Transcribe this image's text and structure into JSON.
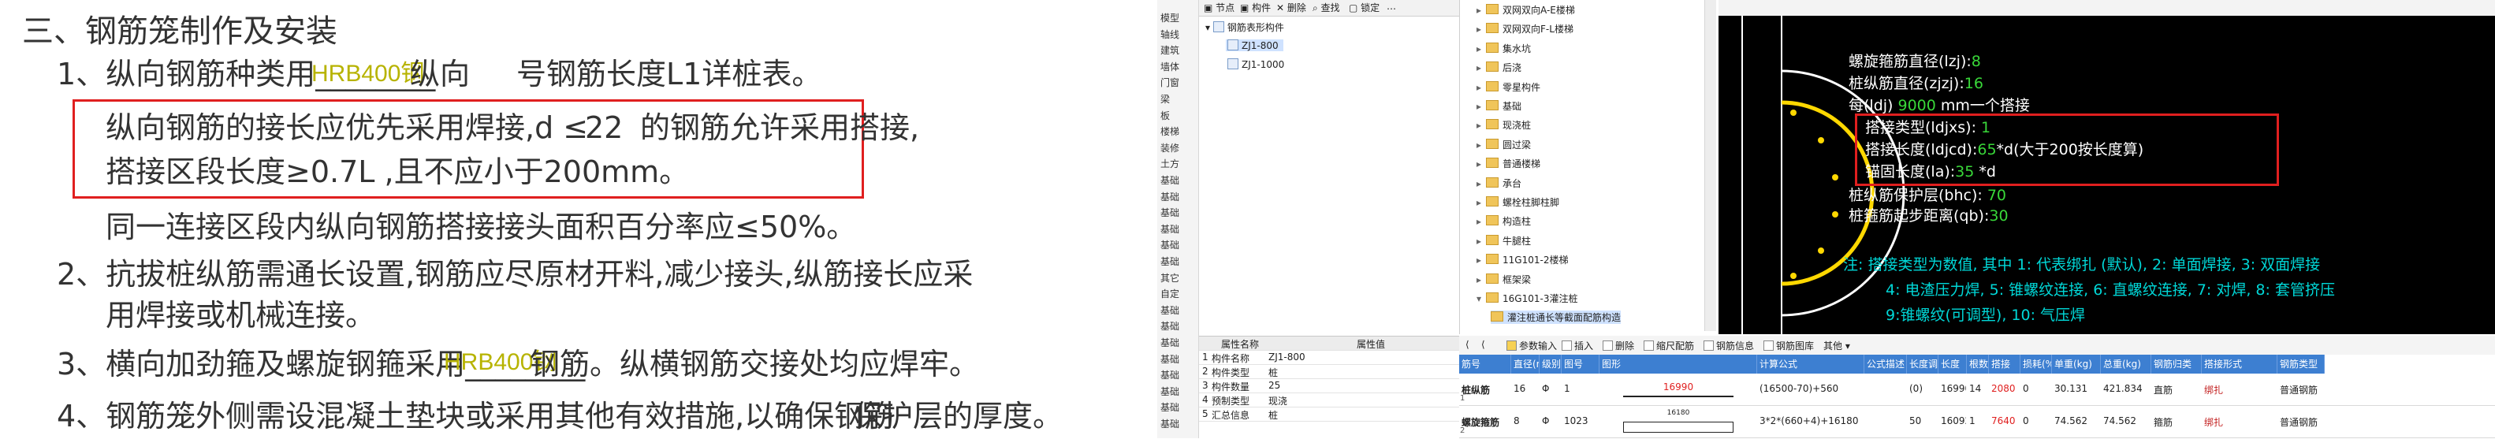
{
  "notes": {
    "heading": "三、钢筋笼制作及安装",
    "line1_a": "1、纵向钢筋种类用",
    "line1_blank": "________",
    "line1_b": "纵向",
    "line1_c": "号钢筋长度L1详桩表。",
    "hrb_1": "HRB400钢",
    "line1_overlap": "筋长度",
    "line2": "纵向钢筋的接长应优先采用焊接,d ≤",
    "line2_num": "22",
    "line2_end": "的钢筋允许采用搭接,",
    "line3": "搭接区段长度≥0.7L  ,且不应小于200mm。",
    "line4": "同一连接区段内纵向钢筋搭接接头面积百分率应≤50%。",
    "line5": "2、抗拔桩纵筋需通长设置,钢筋应尽原材开料,减少接头,纵筋接长应采",
    "line6": "用焊接或机械连接。",
    "line7_a": "3、横向加劲箍及螺旋钢箍采用",
    "line7_blank": "________",
    "line7_b": "钢筋。纵横钢筋交接处均应焊牢。",
    "hrb_2": "HRB400钢",
    "line8_a": "4、钢筋笼外侧需设混凝土垫块或采用其他有效措施,以确保钢筋",
    "line8_b": "保护层的厚度。"
  },
  "side_strip": [
    "模型",
    "轴线",
    "建筑",
    "墙体",
    "门窗",
    "梁",
    "板",
    "楼梯",
    "装修",
    "土方",
    "基础",
    "基础",
    "基础",
    "基础",
    "基础",
    "基础",
    "其它",
    "自定",
    "基础",
    "基础",
    "基础",
    "基础",
    "基础",
    "基础",
    "基础",
    "基础"
  ],
  "comp_toolbar": [
    "节点",
    "构件",
    "删除",
    "查找",
    "锁定",
    "…"
  ],
  "comp_tree": {
    "root": "钢筋表形构件",
    "items": [
      "ZJ1-800",
      "ZJ1-1000"
    ]
  },
  "lib_tree": [
    "双网双向A-E楼梯",
    "双网双向F-L楼梯",
    "集水坑",
    "后浇",
    "零星构件",
    "基础",
    "现浇桩",
    "圆过梁",
    "普通楼梯",
    "承台",
    "螺栓柱脚柱脚",
    "构造柱",
    "牛腿柱",
    "11G101-2楼梯",
    "框架梁",
    "16G101-3灌注桩",
    "灌注桩通长等截面配筋构造"
  ],
  "props": {
    "head": [
      "属性名称",
      "属性值"
    ],
    "rows": [
      [
        "1",
        "构件名称",
        "ZJ1-800"
      ],
      [
        "2",
        "构件类型",
        "桩"
      ],
      [
        "3",
        "构件数量",
        "25"
      ],
      [
        "4",
        "预制类型",
        "现浇"
      ],
      [
        "5",
        "汇总信息",
        "桩"
      ]
    ]
  },
  "preview": {
    "l1_label": "螺旋箍筋直径(lzj):",
    "l1_val": "8",
    "l2_label": "桩纵筋直径(zjzj):",
    "l2_val": "16",
    "l3_a": "每(ldj)",
    "l3_val": "9000",
    "l3_b": "mm一个搭接",
    "l4_label": "搭接类型(ldjxs):",
    "l4_val": "1",
    "l5_label": "搭接长度(ldjcd):",
    "l5_val": "65",
    "l5_b": "*d(大于200按长度算)",
    "l6_label": "锚固长度(la):",
    "l6_val": "35",
    "l6_b": "*d",
    "l7_label": "桩纵筋保护层(bhc):",
    "l7_val": "70",
    "l8_label": "桩箍筋起步距离(qb):",
    "l8_val": "30",
    "note1": "注: 搭接类型为数值, 其中 1: 代表绑扎 (默认), 2: 单面焊接, 3: 双面焊接",
    "note2": "4: 电渣压力焊, 5: 锥螺纹连接, 6: 直螺纹连接, 7: 对焊, 8: 套管挤压",
    "note3": "9:锥螺纹(可调型), 10: 气压焊"
  },
  "rebar_toolbar": [
    "参数输入",
    "插入",
    "删除",
    "缩尺配筋",
    "钢筋信息",
    "钢筋图库",
    "其他"
  ],
  "rebar_table": {
    "headers": [
      "筋号",
      "直径(mm)",
      "级别",
      "图号",
      "图形",
      "计算公式",
      "公式描述",
      "长度调整",
      "长度",
      "根数",
      "搭接",
      "损耗(%)",
      "单重(kg)",
      "总重(kg)",
      "钢筋归类",
      "搭接形式",
      "钢筋类型"
    ],
    "rows": [
      {
        "idx": "1",
        "name": "桩纵筋",
        "dia": "16",
        "grade": "Φ",
        "fig": "1",
        "shape_val": "16990",
        "formula": "(16500-70)+560",
        "desc": "",
        "adj": "(0)",
        "len": "16990",
        "count": "14",
        "lap": "2080",
        "loss": "0",
        "unit": "30.131",
        "total": "421.834",
        "cat": "直筋",
        "laptype": "绑扎",
        "type": "普通钢筋"
      },
      {
        "idx": "2",
        "name": "螺旋箍筋",
        "dia": "8",
        "grade": "Φ",
        "fig": "1023",
        "shape_val": "16180",
        "formula": "3*2*(660+4)+16180",
        "desc": "",
        "adj": "50",
        "len": "16092",
        "count": "1",
        "lap": "7640",
        "loss": "0",
        "unit": "74.562",
        "total": "74.562",
        "cat": "箍筋",
        "laptype": "绑扎",
        "type": "普通钢筋"
      }
    ]
  },
  "colors": {
    "accent": "#3d7fd1",
    "highlight": "#e01f1f",
    "value_green": "#39d839",
    "note_cyan": "#00d7d7",
    "hrb_yellow": "#b7b300"
  }
}
